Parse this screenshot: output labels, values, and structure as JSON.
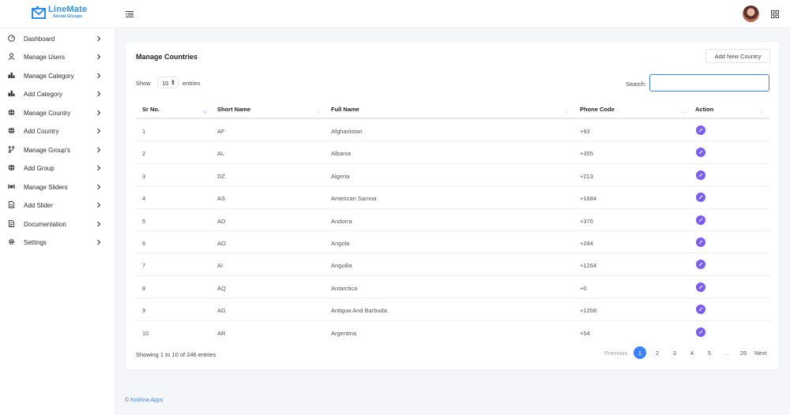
{
  "header": {
    "logo_title": "LineMate",
    "logo_subtitle": "Social Groups"
  },
  "sidebar": {
    "items": [
      {
        "label": "Dashboard",
        "icon": "dashboard-icon"
      },
      {
        "label": "Manage Users",
        "icon": "user-icon"
      },
      {
        "label": "Manage Category",
        "icon": "category-icon"
      },
      {
        "label": "Add Category",
        "icon": "category-icon"
      },
      {
        "label": "Manage Country",
        "icon": "globe-icon"
      },
      {
        "label": "Add Country",
        "icon": "globe-icon"
      },
      {
        "label": "Manage Group's",
        "icon": "branch-icon"
      },
      {
        "label": "Add Group",
        "icon": "globe-icon"
      },
      {
        "label": "Manage Sliders",
        "icon": "slider-icon"
      },
      {
        "label": "Add Slider",
        "icon": "file-icon"
      },
      {
        "label": "Documentation",
        "icon": "document-icon"
      },
      {
        "label": "Settings",
        "icon": "gear-icon"
      }
    ]
  },
  "main": {
    "title": "Manage Countries",
    "add_button": "Add New Country",
    "show_label": "Show",
    "entries_value": "10",
    "entries_label": "entries",
    "search_label": "Search:",
    "search_value": "",
    "columns": [
      "Sr No.",
      "Short Name",
      "Full Name",
      "Phone Code",
      "Action"
    ],
    "rows": [
      [
        "1",
        "AF",
        "Afghanistan",
        "+93"
      ],
      [
        "2",
        "AL",
        "Albania",
        "+355"
      ],
      [
        "3",
        "DZ",
        "Algeria",
        "+213"
      ],
      [
        "4",
        "AS",
        "American Samoa",
        "+1684"
      ],
      [
        "5",
        "AD",
        "Andorra",
        "+376"
      ],
      [
        "6",
        "AO",
        "Angola",
        "+244"
      ],
      [
        "7",
        "AI",
        "Anguilla",
        "+1264"
      ],
      [
        "8",
        "AQ",
        "Antarctica",
        "+0"
      ],
      [
        "9",
        "AG",
        "Antigua And Barbuda",
        "+1268"
      ],
      [
        "10",
        "AR",
        "Argentina",
        "+54"
      ]
    ],
    "info": "Showing 1 to 10 of 246 entries",
    "pagination": {
      "previous": "Previous",
      "pages": [
        "1",
        "2",
        "3",
        "4",
        "5",
        "…",
        "25"
      ],
      "current": "1",
      "next": "Next"
    }
  },
  "footer": {
    "copyright_symbol": "©",
    "company": "Krishna Apps"
  },
  "colors": {
    "brand": "#2f8fe6",
    "accent": "#3b82f6",
    "action": "#7b5cf0"
  }
}
